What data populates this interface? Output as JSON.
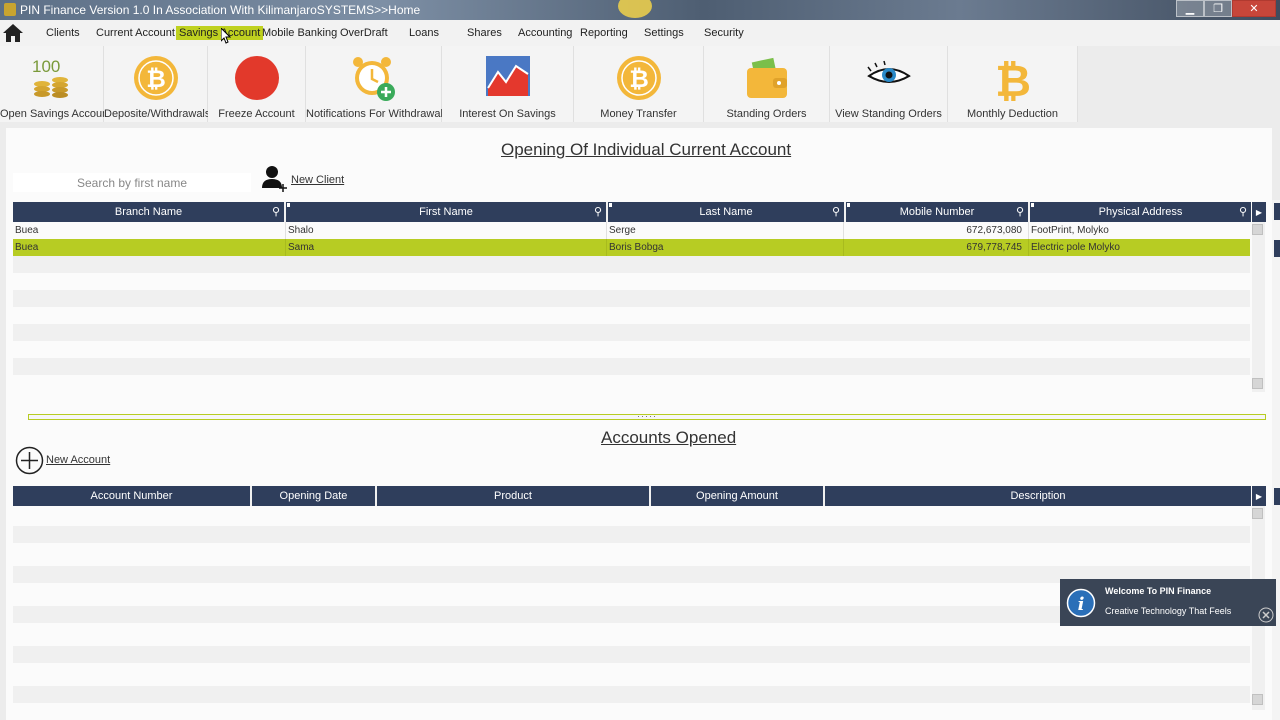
{
  "window": {
    "title": "PIN Finance Version 1.0 In Association With KilimanjaroSYSTEMS>>Home",
    "minimize_label": "▁",
    "maximize_label": "❐",
    "close_label": "✕"
  },
  "menu": {
    "items": [
      {
        "label": "Clients"
      },
      {
        "label": "Current Account"
      },
      {
        "label": "Savings Account",
        "active": true
      },
      {
        "label": "Mobile Banking"
      },
      {
        "label": "OverDraft"
      },
      {
        "label": "Loans"
      },
      {
        "label": "Shares"
      },
      {
        "label": "Accounting"
      },
      {
        "label": "Reporting"
      },
      {
        "label": "Settings"
      },
      {
        "label": "Security"
      }
    ]
  },
  "ribbon": {
    "buttons": [
      {
        "label": "Open Savings Account",
        "icon": "coins-100-icon"
      },
      {
        "label": "Deposite/Withdrawals",
        "icon": "bitcoin-icon"
      },
      {
        "label": "Freeze Account",
        "icon": "red-circle-icon"
      },
      {
        "label": "Notifications For Withdrawals",
        "icon": "alarm-clock-add-icon"
      },
      {
        "label": "Interest On Savings",
        "icon": "line-chart-icon"
      },
      {
        "label": "Money Transfer",
        "icon": "bitcoin-icon"
      },
      {
        "label": "Standing Orders",
        "icon": "wallet-icon"
      },
      {
        "label": "View Standing Orders",
        "icon": "eye-icon"
      },
      {
        "label": "Monthly Deduction",
        "icon": "bitcoin-symbol-icon"
      }
    ]
  },
  "clients_section": {
    "title": "Opening Of Individual Current Account",
    "search_placeholder": "Search by first name",
    "new_client_label": "New Client",
    "columns": [
      "Branch Name",
      "First Name",
      "Last Name",
      "Mobile Number",
      "Physical Address"
    ],
    "rows": [
      {
        "branch": "Buea",
        "first_name": "Shalo",
        "last_name": "Serge",
        "mobile": "672,673,080",
        "address": "FootPrint, Molyko",
        "selected": false
      },
      {
        "branch": "Buea",
        "first_name": "Sama",
        "last_name": "Boris Bobga",
        "mobile": "679,778,745",
        "address": "Electric pole Molyko",
        "selected": true
      }
    ]
  },
  "accounts_section": {
    "title": "Accounts Opened",
    "new_account_label": "New Account",
    "columns": [
      "Account Number",
      "Opening Date",
      "Product",
      "Opening Amount",
      "Description"
    ],
    "rows": []
  },
  "splitter_grip": "·····",
  "toast": {
    "title": "Welcome To PIN Finance",
    "body": "Creative Technology That Feels"
  },
  "colors": {
    "header_bg": "#2f3e5c",
    "accent": "#b7cc23"
  }
}
